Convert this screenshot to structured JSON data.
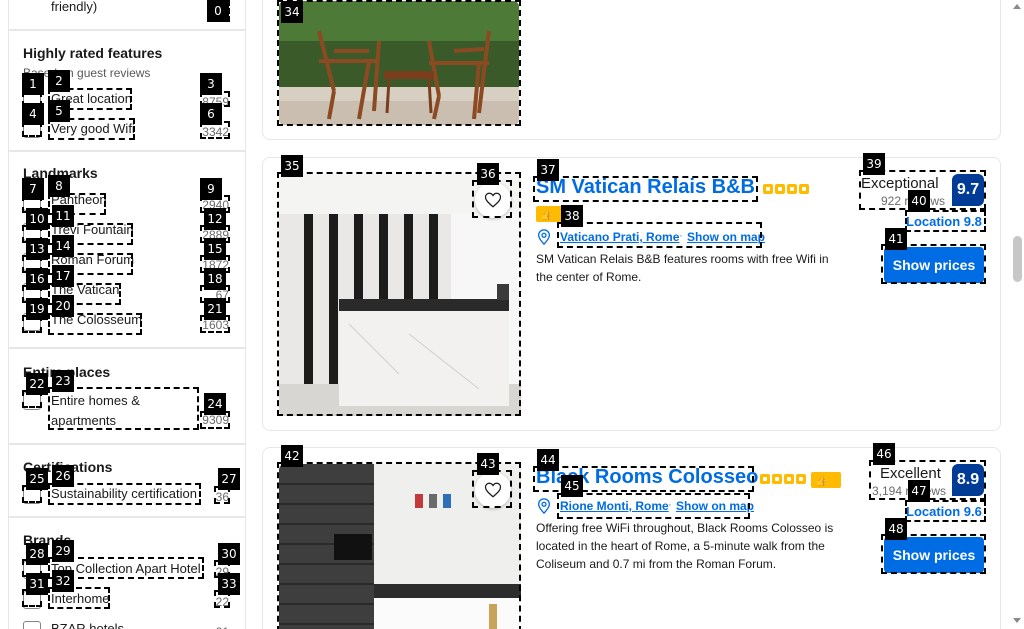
{
  "sidebar": {
    "top_fragment": {
      "label": "friendly)",
      "count": "0"
    },
    "highly_rated": {
      "title": "Highly rated features",
      "subtitle": "Based on guest reviews",
      "items": [
        {
          "label": "Great location",
          "count": "8759"
        },
        {
          "label": "Very good Wifi",
          "count": "3342"
        }
      ]
    },
    "landmarks": {
      "title": "Landmarks",
      "items": [
        {
          "label": "Pantheon",
          "count": "2940"
        },
        {
          "label": "Trevi Fountain",
          "count": "2889"
        },
        {
          "label": "Roman Forum",
          "count": "1872"
        },
        {
          "label": "The Vatican",
          "count": "67"
        },
        {
          "label": "The Colosseum",
          "count": "1603"
        }
      ]
    },
    "entire_places": {
      "title": "Entire places",
      "items": [
        {
          "label": "Entire homes & apartments",
          "count": "9309"
        }
      ]
    },
    "certifications": {
      "title": "Certifications",
      "items": [
        {
          "label": "Sustainability certification",
          "count": "36"
        }
      ]
    },
    "brands": {
      "title": "Brands",
      "items": [
        {
          "label": "Top Collection Apart Hotel",
          "count": "29"
        },
        {
          "label": "Interhome",
          "count": "22"
        },
        {
          "label": "BZAR hotels",
          "count": "21"
        }
      ]
    }
  },
  "listings": [
    {
      "name": "SM Vatican Relais B&B",
      "area": "Vaticano Prati, Rome",
      "map_link": "Show on map",
      "description": "SM Vatican Relais B&B features rooms with free Wifi in the center of Rome.",
      "score_word": "Exceptional",
      "reviews": "922 reviews",
      "score": "9.7",
      "location_score": "Location 9.8",
      "button": "Show prices",
      "stars": 4
    },
    {
      "name": "Black Rooms Colosseo",
      "area": "Rione Monti, Rome",
      "map_link": "Show on map",
      "description": "Offering free WiFi throughout, Black Rooms Colosseo is located in the heart of Rome, a 5-minute walk from the Coliseum and 0.7 mi from the Roman Forum.",
      "score_word": "Excellent",
      "reviews": "3,194 reviews",
      "score": "8.9",
      "location_score": "Location 9.6",
      "button": "Show prices",
      "stars": 4
    }
  ],
  "markers": [
    "0",
    "1",
    "2",
    "3",
    "4",
    "5",
    "6",
    "7",
    "8",
    "9",
    "10",
    "11",
    "12",
    "13",
    "14",
    "15",
    "16",
    "17",
    "18",
    "19",
    "20",
    "21",
    "22",
    "23",
    "24",
    "25",
    "26",
    "27",
    "28",
    "29",
    "30",
    "31",
    "32",
    "33",
    "34",
    "35",
    "36",
    "37",
    "38",
    "39",
    "40",
    "41",
    "42",
    "43",
    "44",
    "45",
    "46",
    "47",
    "48"
  ],
  "colors": {
    "brand_blue": "#006ce4",
    "score_navy": "#003b95",
    "star_yellow": "#febb02"
  },
  "icons": [
    "heart-icon",
    "location-pin-icon",
    "thumbs-up-icon",
    "star-icon"
  ]
}
